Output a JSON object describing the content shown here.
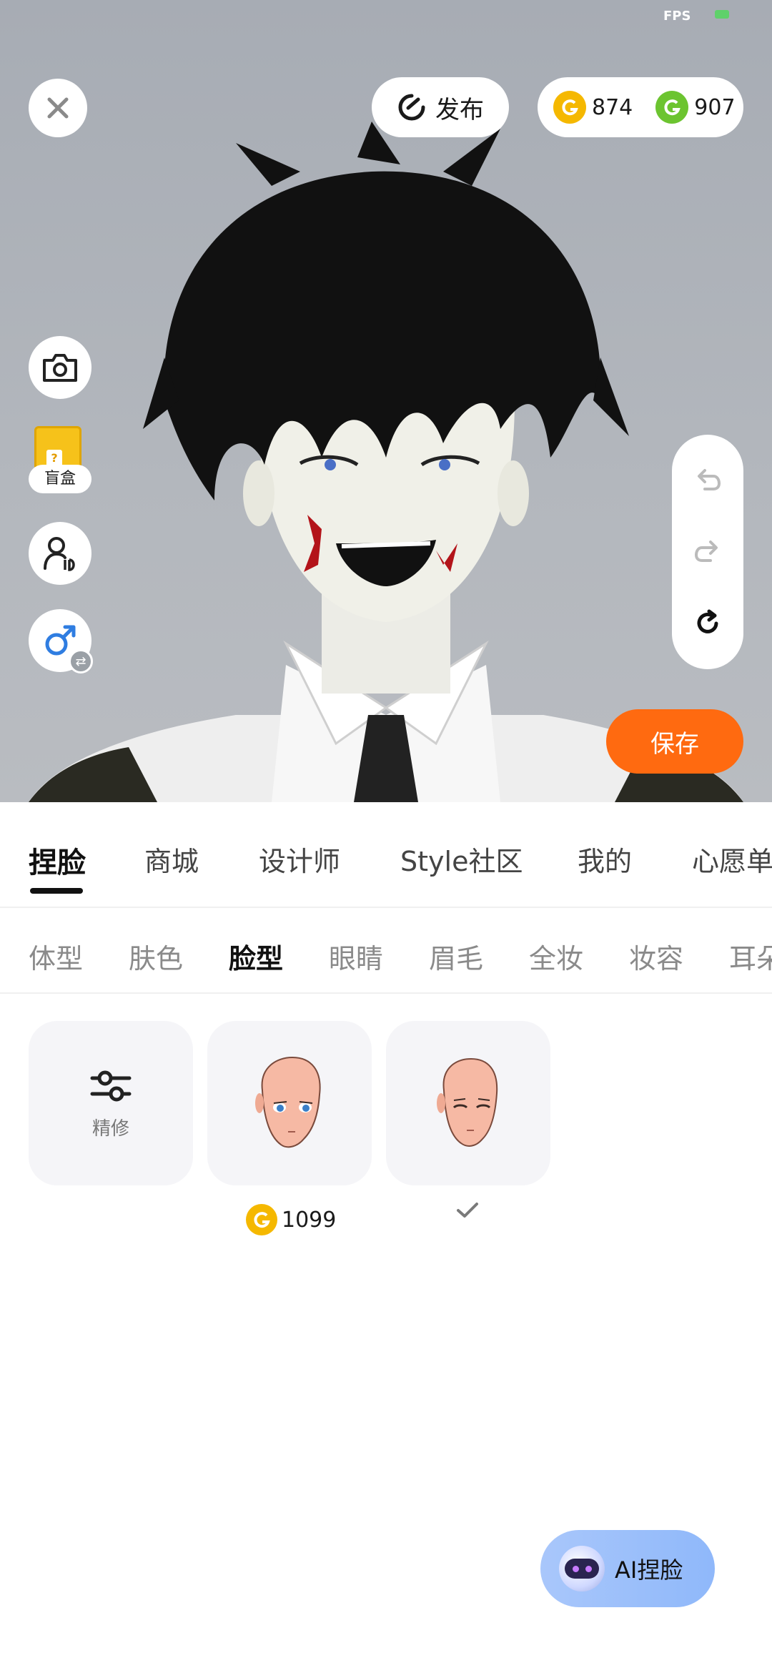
{
  "status": {
    "fps_label": "FPS"
  },
  "top_bar": {
    "publish_label": "发布",
    "gold_coins": "874",
    "green_coins": "907"
  },
  "side_tools": {
    "blind_box_label": "盲盒"
  },
  "save_label": "保存",
  "main_tabs": [
    {
      "label": "捏脸",
      "active": true
    },
    {
      "label": "商城",
      "active": false
    },
    {
      "label": "设计师",
      "active": false
    },
    {
      "label": "Style社区",
      "active": false
    },
    {
      "label": "我的",
      "active": false
    },
    {
      "label": "心愿单",
      "active": false
    }
  ],
  "sub_tabs": [
    {
      "label": "体型",
      "active": false
    },
    {
      "label": "肤色",
      "active": false
    },
    {
      "label": "脸型",
      "active": true
    },
    {
      "label": "眼睛",
      "active": false
    },
    {
      "label": "眉毛",
      "active": false
    },
    {
      "label": "全妆",
      "active": false
    },
    {
      "label": "妆容",
      "active": false
    },
    {
      "label": "耳朵",
      "active": false
    }
  ],
  "items": [
    {
      "type": "refine",
      "label": "精修"
    },
    {
      "type": "face",
      "price": "1099",
      "selected": false
    },
    {
      "type": "face",
      "price": "",
      "selected": true
    }
  ],
  "ai_button_label": "AI捏脸",
  "colors": {
    "accent_orange": "#ff6a10",
    "gold_coin": "#f5b800",
    "green_coin": "#6cc430",
    "ai_button": "#9cc0fa"
  },
  "icons": [
    "close-icon",
    "publish-refresh-icon",
    "gold-coin-icon",
    "green-coin-icon",
    "camera-icon",
    "blind-box-icon",
    "user-id-icon",
    "male-gender-icon",
    "swap-icon",
    "undo-icon",
    "redo-icon",
    "reset-icon",
    "sliders-icon",
    "check-icon",
    "ai-robot-icon"
  ]
}
